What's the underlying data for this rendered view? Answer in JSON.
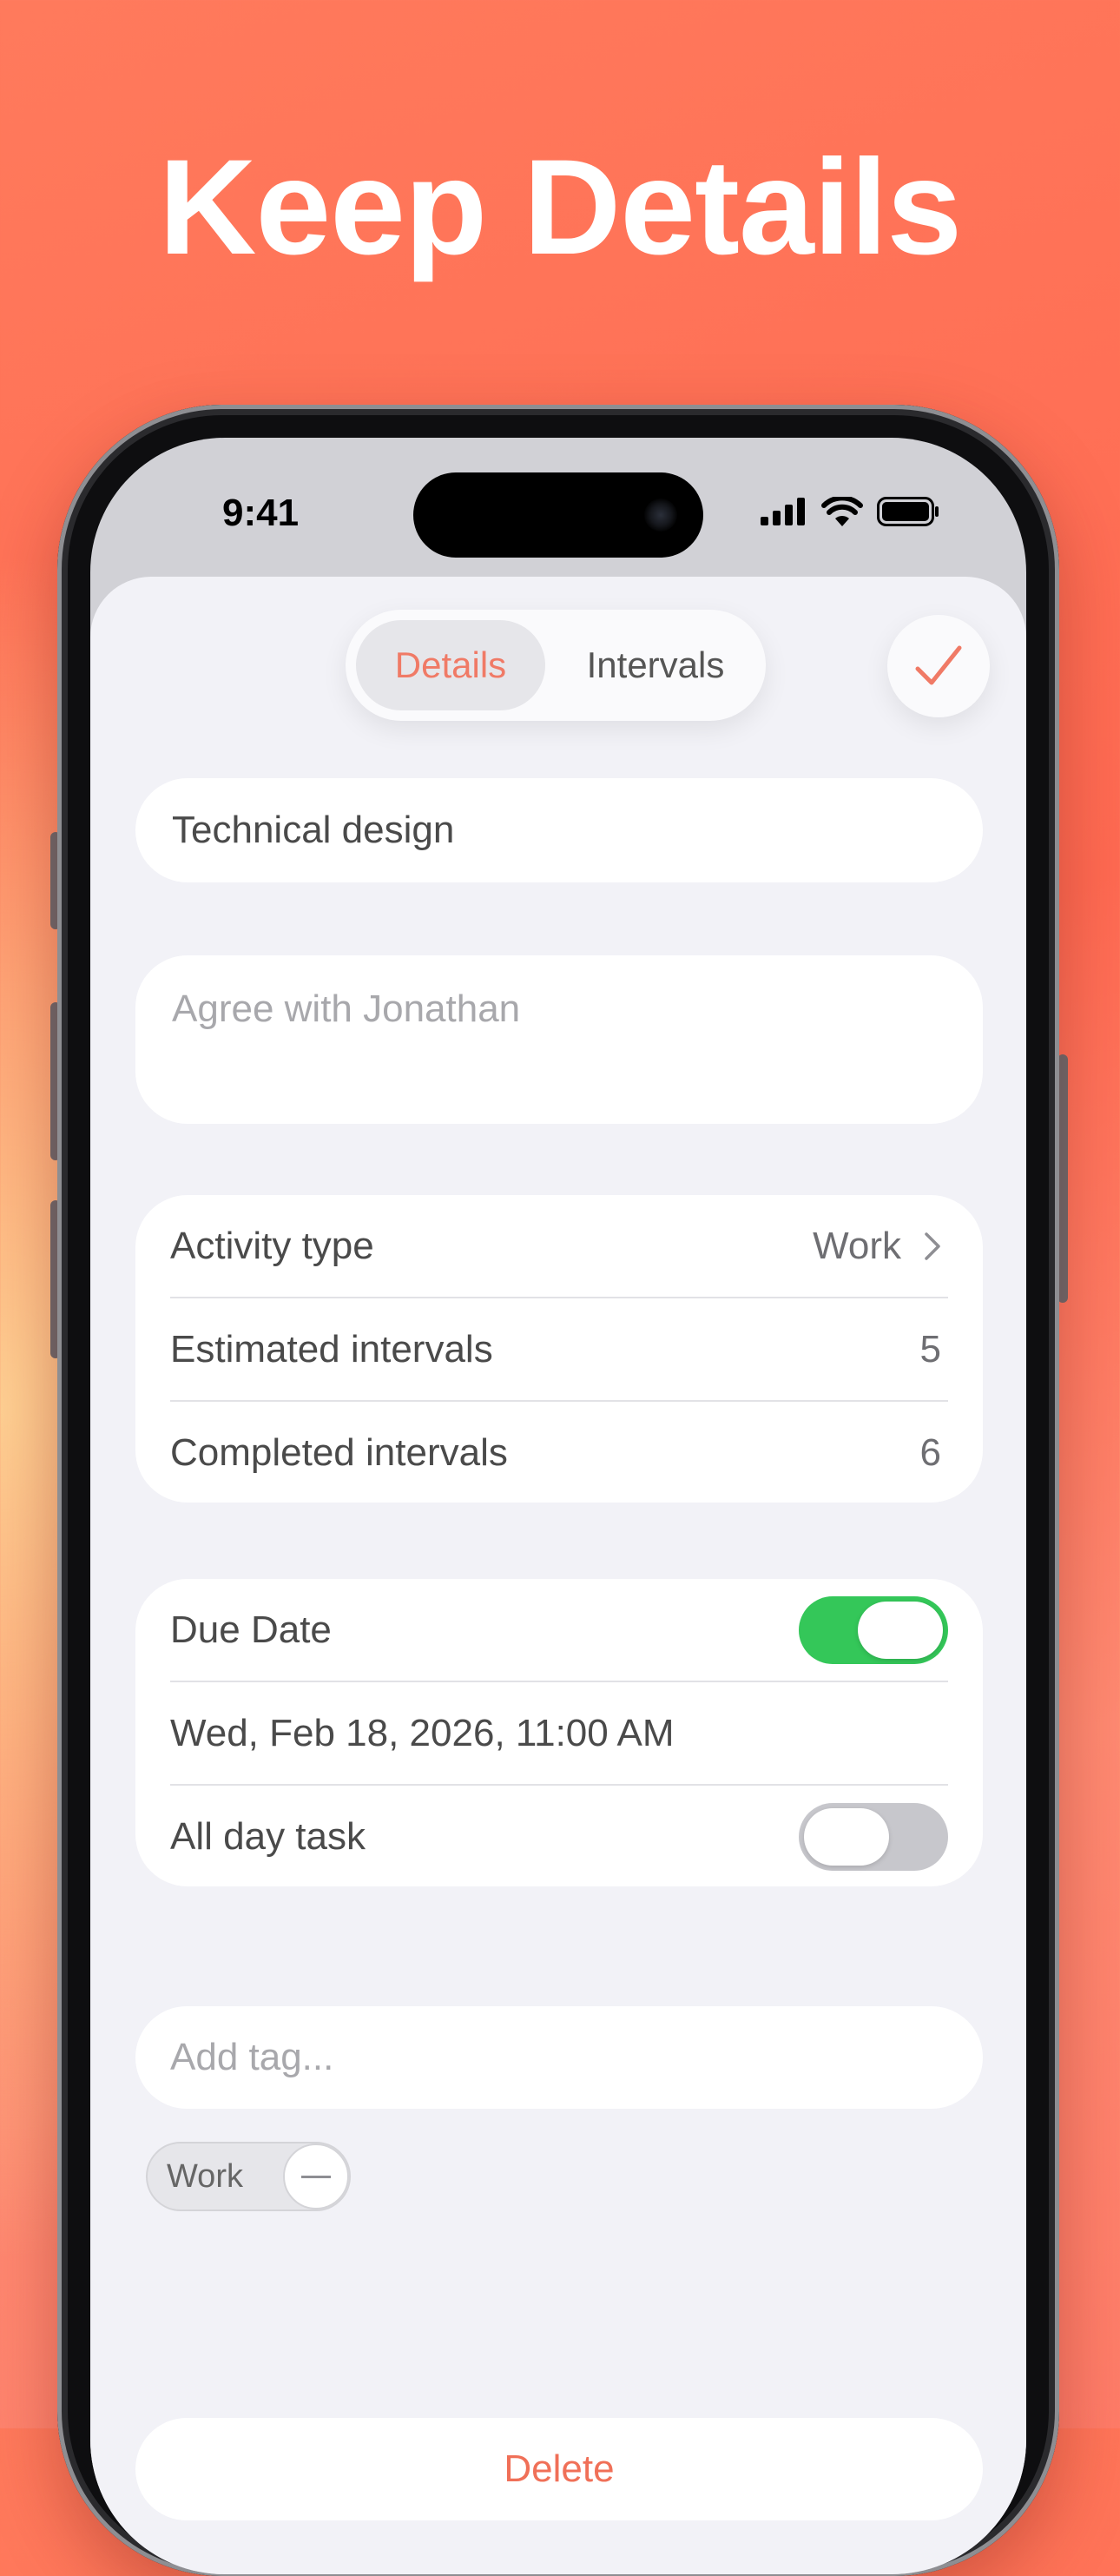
{
  "headline": "Keep Details",
  "status_bar": {
    "time": "9:41"
  },
  "segmented": {
    "details": "Details",
    "intervals": "Intervals",
    "selected": "Details"
  },
  "task": {
    "title": "Technical design",
    "notes_placeholder": "Agree with Jonathan"
  },
  "stats": {
    "activity_label": "Activity type",
    "activity_value": "Work",
    "estimated_label": "Estimated intervals",
    "estimated_value": "5",
    "completed_label": "Completed intervals",
    "completed_value": "6"
  },
  "due": {
    "due_label": "Due Date",
    "due_enabled": true,
    "date_value": "Wed, Feb 18, 2026, 11:00 AM",
    "all_day_label": "All day task",
    "all_day_enabled": false
  },
  "tags": {
    "placeholder": "Add tag...",
    "items": [
      "Work"
    ]
  },
  "delete_label": "Delete",
  "colors": {
    "accent": "#f07a66",
    "toggle_on": "#34c759",
    "toggle_off": "#c7c7cc",
    "background": "#ff6a52"
  },
  "icons": [
    "checkmark-icon",
    "chevron-right-icon",
    "signal-icon",
    "wifi-icon",
    "battery-icon",
    "minus-icon"
  ]
}
